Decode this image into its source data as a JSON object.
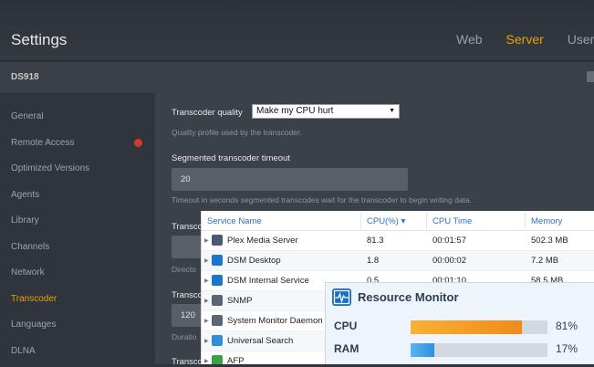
{
  "app": {
    "title": "Settings",
    "tabs": [
      "Web",
      "Server",
      "Users"
    ],
    "active_tab": "Server"
  },
  "server": {
    "name": "DS918"
  },
  "sidebar": {
    "items": [
      "General",
      "Remote Access",
      "Optimized Versions",
      "Agents",
      "Library",
      "Channels",
      "Network",
      "Transcoder",
      "Languages",
      "DLNA"
    ],
    "active": "Transcoder"
  },
  "transcoder": {
    "quality_label": "Transcoder quality",
    "quality_value": "Make my CPU hurt",
    "quality_help": "Quality profile used by the transcoder.",
    "timeout_label": "Segmented transcoder timeout",
    "timeout_value": "20",
    "timeout_help": "Timeout in seconds segmented transcodes wait for the transcoder to begin writing data.",
    "partial_labels": [
      "Transco",
      "Transco",
      "Transco"
    ],
    "partial_help": [
      "Directo",
      "Duratio"
    ],
    "partial_value": "120"
  },
  "process_table": {
    "columns": [
      "Service Name",
      "CPU(%)",
      "CPU Time",
      "Memory"
    ],
    "sort_indicator": "▾",
    "rows": [
      {
        "name": "Plex Media Server",
        "cpu": "81.3",
        "time": "00:01:57",
        "mem": "502.3 MB",
        "icon_color": "#4a5a70"
      },
      {
        "name": "DSM Desktop",
        "cpu": "1.8",
        "time": "00:00:02",
        "mem": "7.2 MB",
        "icon_color": "#1d76c8"
      },
      {
        "name": "DSM Internal Service",
        "cpu": "0.5",
        "time": "00:01:10",
        "mem": "58.5 MB",
        "icon_color": "#1d76c8"
      },
      {
        "name": "SNMP",
        "cpu": "",
        "time": "",
        "mem": "",
        "icon_color": "#5a6675"
      },
      {
        "name": "System Monitor Daemon",
        "cpu": "",
        "time": "",
        "mem": "",
        "icon_color": "#5a6675"
      },
      {
        "name": "Universal Search",
        "cpu": "",
        "time": "",
        "mem": "",
        "icon_color": "#2e8fd8"
      },
      {
        "name": "AFP",
        "cpu": "",
        "time": "",
        "mem": "",
        "icon_color": "#3aa04a"
      }
    ]
  },
  "resource_monitor": {
    "title": "Resource Monitor",
    "cpu_label": "CPU",
    "cpu_value": "81%",
    "cpu_fraction": 0.81,
    "ram_label": "RAM",
    "ram_value": "17%",
    "ram_fraction": 0.17,
    "colors": {
      "accent": "#e5a00d",
      "cpu_bar": "#f08a1c",
      "ram_bar": "#2e8fe0"
    }
  }
}
